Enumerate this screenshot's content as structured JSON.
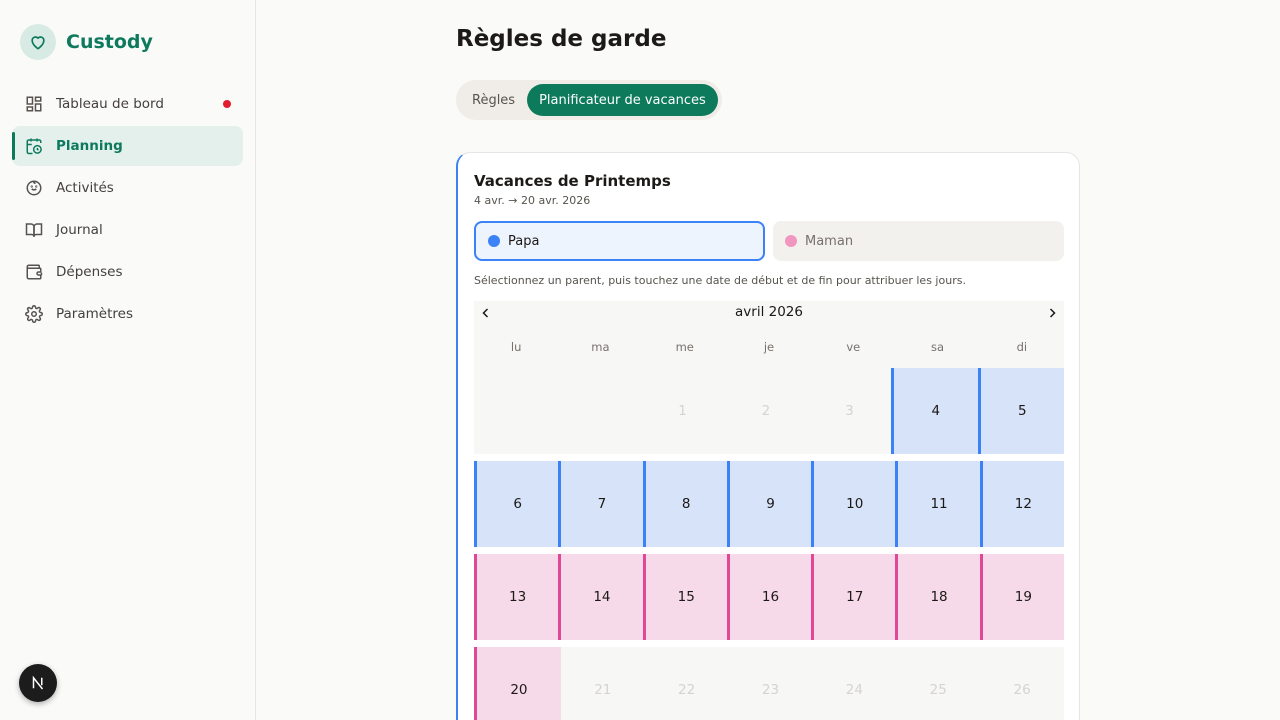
{
  "brand": {
    "name": "Custody"
  },
  "sidebar": {
    "items": [
      {
        "label": "Tableau de bord"
      },
      {
        "label": "Planning"
      },
      {
        "label": "Activités"
      },
      {
        "label": "Journal"
      },
      {
        "label": "Dépenses"
      },
      {
        "label": "Paramètres"
      }
    ]
  },
  "page": {
    "title": "Règles de garde"
  },
  "tabs": [
    "Règles",
    "Planificateur de vacances"
  ],
  "card": {
    "title": "Vacances de Printemps",
    "dates": "4 avr. → 20 avr. 2026",
    "parents": [
      {
        "name": "Papa",
        "color": "#3b82f6"
      },
      {
        "name": "Maman",
        "color": "#f096bf"
      }
    ],
    "hint": "Sélectionnez un parent, puis touchez une date de début et de fin pour attribuer les jours."
  },
  "calendar": {
    "month": "avril 2026",
    "weekdays": [
      "lu",
      "ma",
      "me",
      "je",
      "ve",
      "sa",
      "di"
    ],
    "weeks": [
      [
        "",
        "",
        "1",
        "2",
        "3",
        "4",
        "5"
      ],
      [
        "6",
        "7",
        "8",
        "9",
        "10",
        "11",
        "12"
      ],
      [
        "13",
        "14",
        "15",
        "16",
        "17",
        "18",
        "19"
      ],
      [
        "20",
        "21",
        "22",
        "23",
        "24",
        "25",
        "26"
      ]
    ],
    "assignments": {
      "papa": [
        "4",
        "5",
        "6",
        "7",
        "8",
        "9",
        "10",
        "11",
        "12"
      ],
      "maman": [
        "13",
        "14",
        "15",
        "16",
        "17",
        "18",
        "19",
        "20"
      ]
    }
  },
  "colors": {
    "accent": "#0d7a5c",
    "papa": "#3b82f6",
    "maman": "#e04896",
    "notification": "#e11d2e"
  }
}
